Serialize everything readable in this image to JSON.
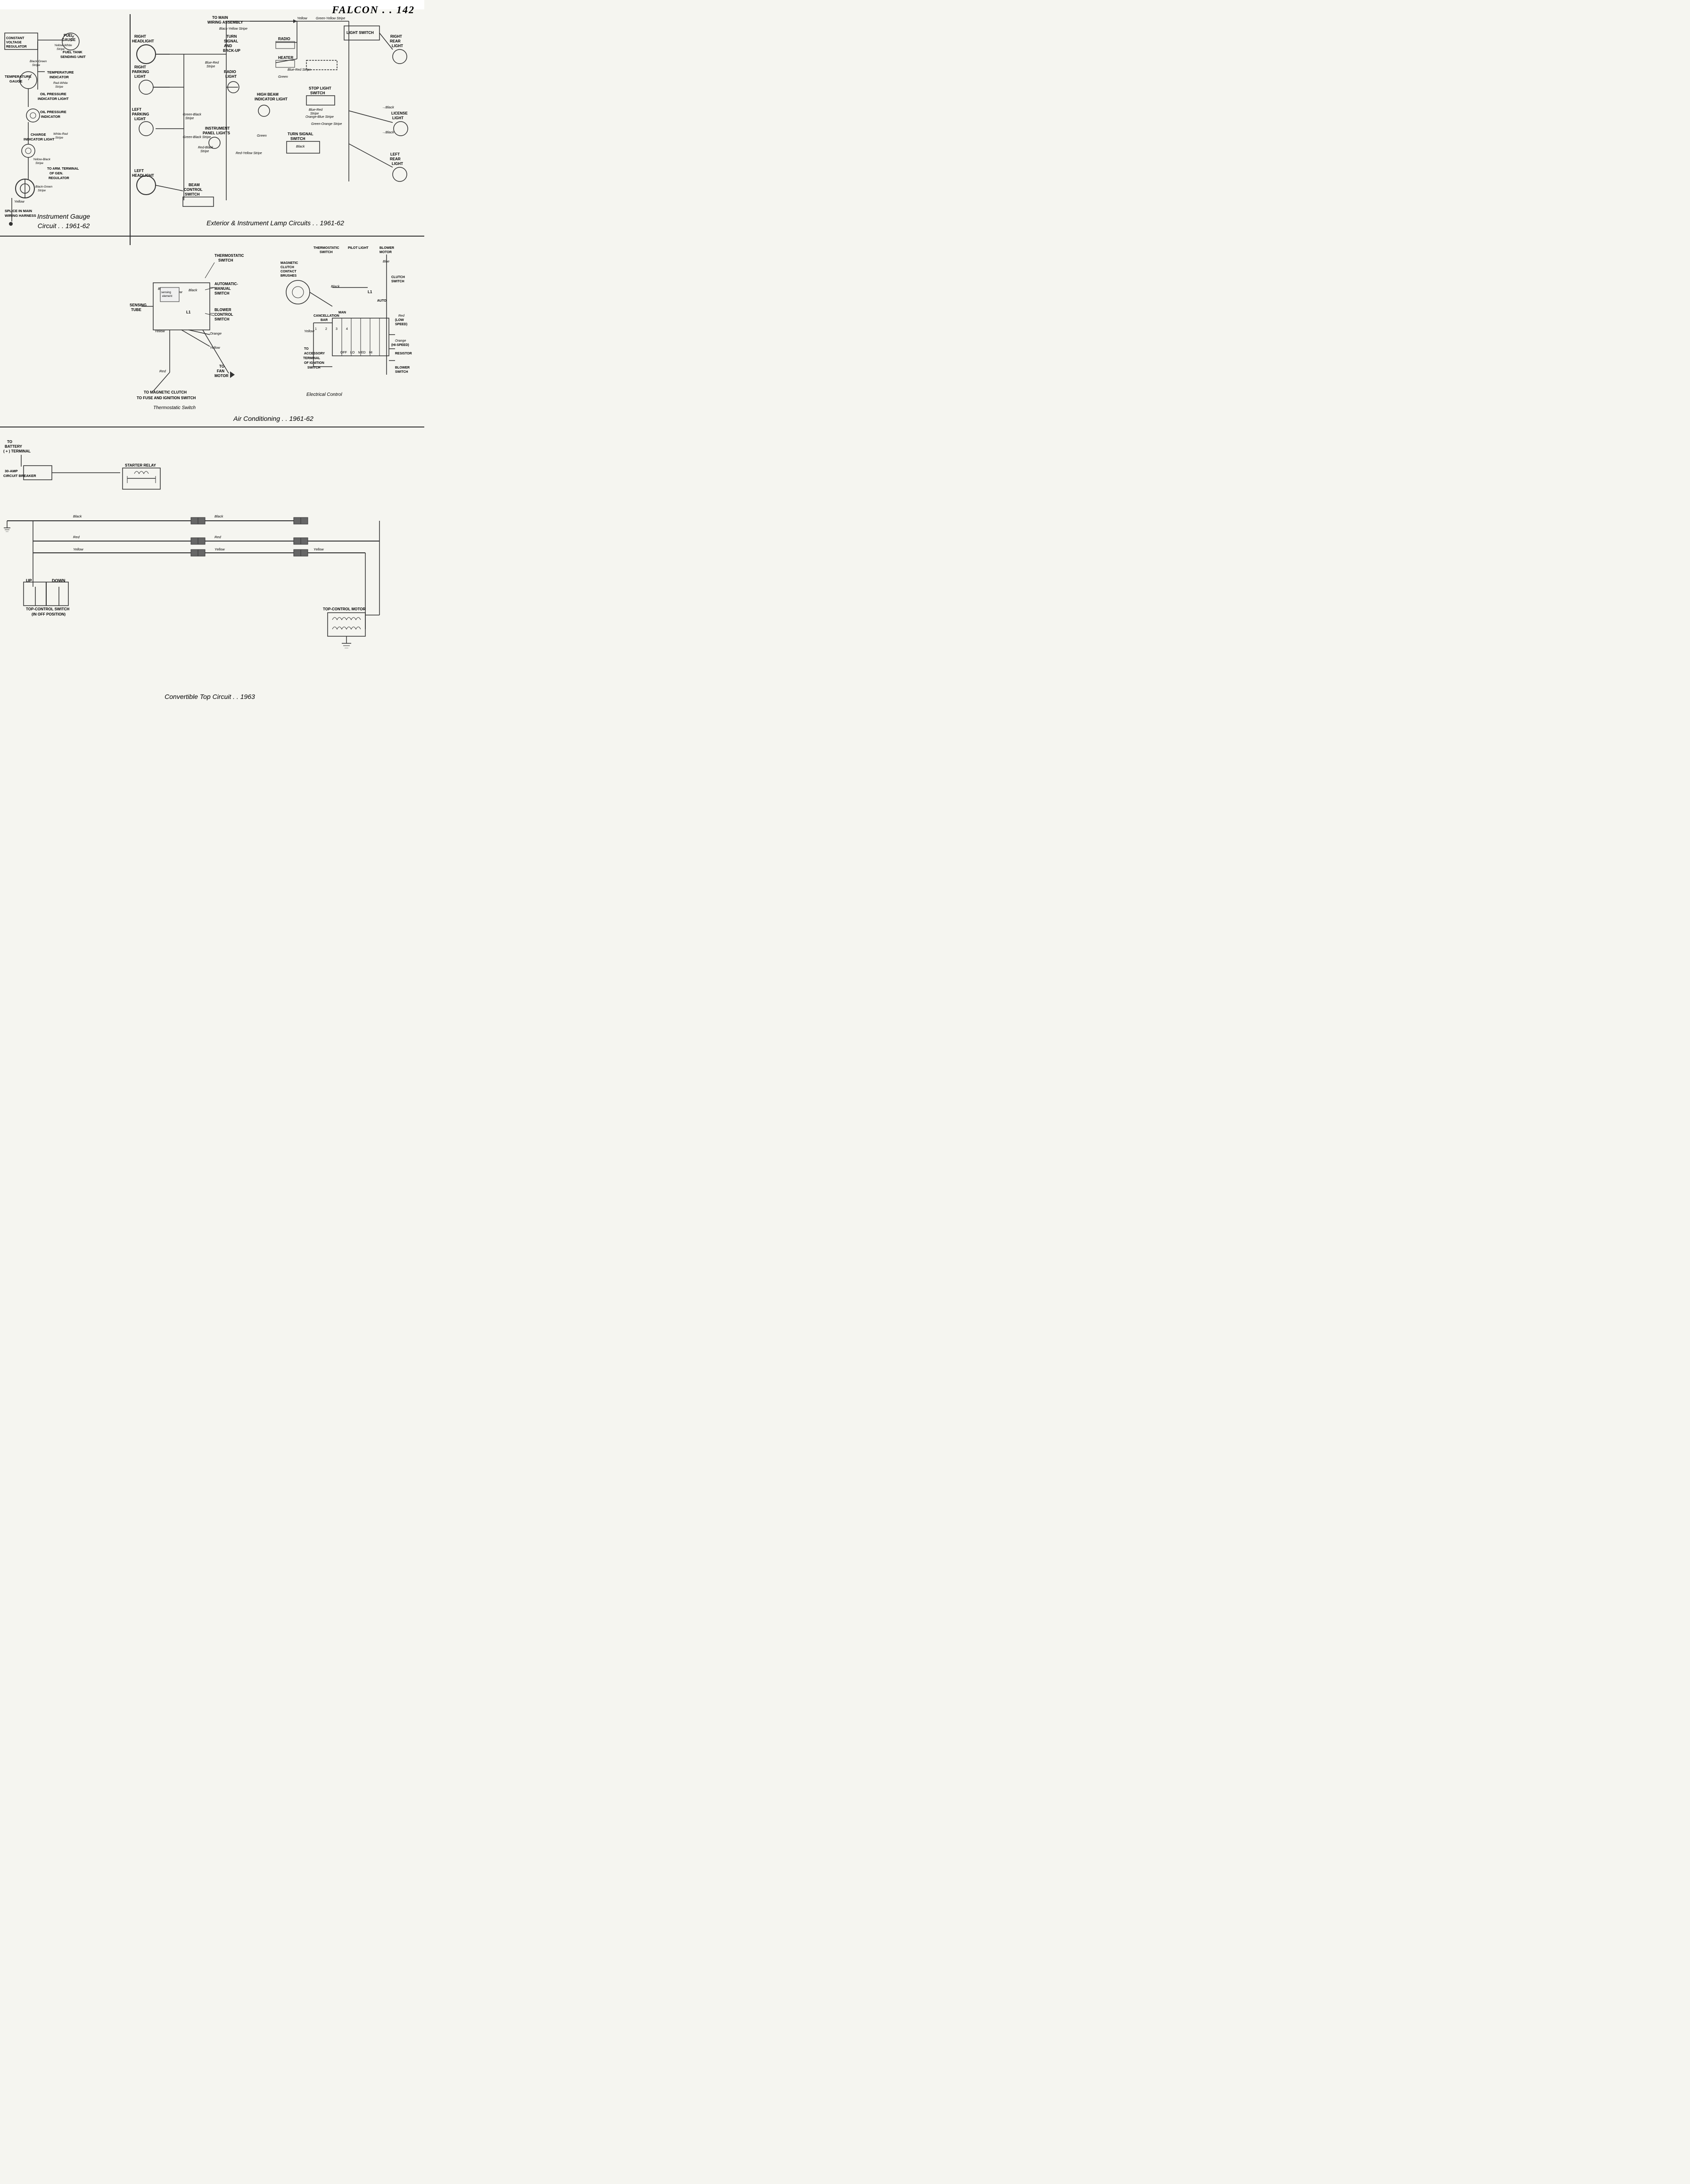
{
  "page": {
    "title": "FALCON . . 142",
    "sections": [
      {
        "id": "instrument-gauge",
        "title": "Instrument Gauge Circuit . . 1961-62"
      },
      {
        "id": "exterior-lamp",
        "title": "Exterior & Instrument Lamp Circuits . . 1961-62"
      },
      {
        "id": "air-conditioning",
        "title": "Air Conditioning . . 1961-62"
      },
      {
        "id": "convertible-top",
        "title": "Convertible Top Circuit . . 1963"
      }
    ],
    "labels": {
      "fuel_tank": "FUEL TANK SENDING UNiT",
      "blower_control": "BLOWER CONTROL SWITCh",
      "black_wire": "Black"
    }
  }
}
